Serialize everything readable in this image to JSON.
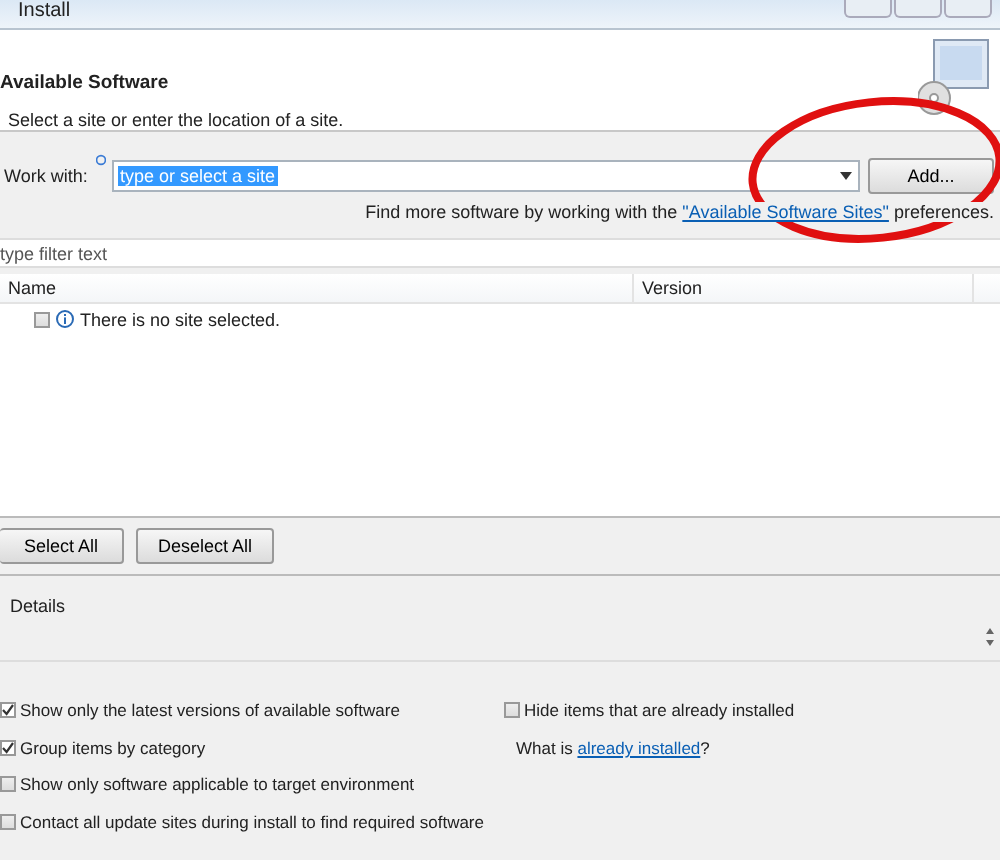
{
  "window": {
    "title": "Install"
  },
  "header": {
    "title": "Available Software",
    "subtitle": "Select a site or enter the location of a site."
  },
  "work_with": {
    "label": "Work with:",
    "value": "type or select a site",
    "text_selected": true,
    "button": "Add..."
  },
  "more_software": {
    "text_before": "Find more software by working with the",
    "link": "\"Available Software Sites\"",
    "text_after": "preferences."
  },
  "filter": {
    "placeholder": "type filter text"
  },
  "table": {
    "columns": [
      "Name",
      "Version"
    ],
    "rows": [
      {
        "checked": false,
        "message": "There is no site selected."
      }
    ]
  },
  "buttons": [
    "Select All",
    "Deselect All"
  ],
  "details": {
    "label": "Details"
  },
  "options_left": [
    {
      "label": "Show only the latest versions of available software",
      "checked": true
    },
    {
      "label": "Group items by category",
      "checked": true
    },
    {
      "label": "Show only software applicable to target environment",
      "checked": false
    },
    {
      "label": "Contact all update sites during install to find required software",
      "checked": false
    }
  ],
  "options_right": [
    {
      "kind": "checkbox",
      "label": "Hide items that are already installed",
      "checked": false
    },
    {
      "kind": "link",
      "text": "What is",
      "link": "already installed",
      "after": "?"
    }
  ]
}
